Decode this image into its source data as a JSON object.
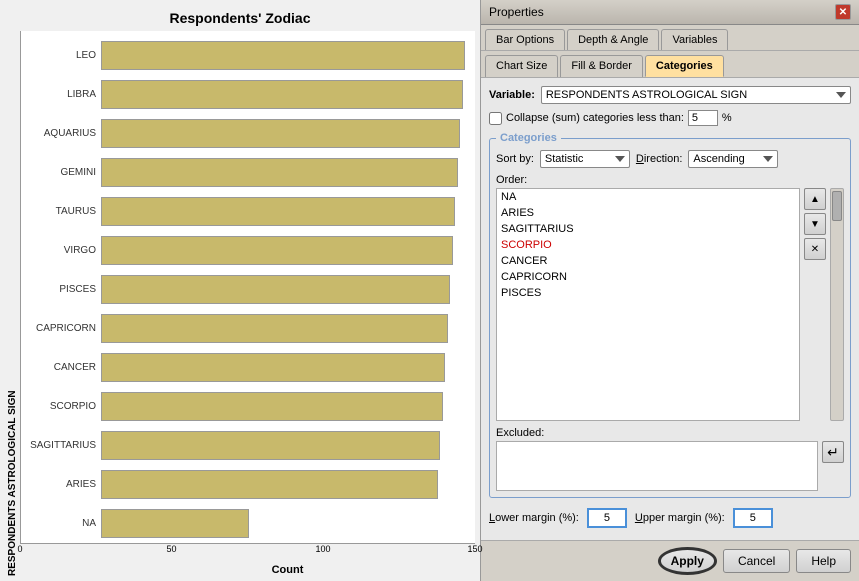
{
  "chart": {
    "title": "Respondents' Zodiac",
    "y_axis_label": "RESPONDENTS ASTROLOGICAL SIGN",
    "x_axis_label": "Count",
    "x_ticks": [
      "0",
      "50",
      "100",
      "150"
    ],
    "bars": [
      {
        "label": "LEO",
        "value": 148,
        "max": 150
      },
      {
        "label": "LIBRA",
        "value": 147,
        "max": 150
      },
      {
        "label": "AQUARIUS",
        "value": 146,
        "max": 150
      },
      {
        "label": "GEMINI",
        "value": 145,
        "max": 150
      },
      {
        "label": "TAURUS",
        "value": 144,
        "max": 150
      },
      {
        "label": "VIRGO",
        "value": 143,
        "max": 150
      },
      {
        "label": "PISCES",
        "value": 142,
        "max": 150
      },
      {
        "label": "CAPRICORN",
        "value": 141,
        "max": 150
      },
      {
        "label": "CANCER",
        "value": 140,
        "max": 150
      },
      {
        "label": "SCORPIO",
        "value": 139,
        "max": 150
      },
      {
        "label": "SAGITTARIUS",
        "value": 138,
        "max": 150
      },
      {
        "label": "ARIES",
        "value": 137,
        "max": 150
      },
      {
        "label": "NA",
        "value": 60,
        "max": 150
      }
    ]
  },
  "panel": {
    "title": "Properties",
    "tabs_row1": [
      {
        "label": "Bar Options",
        "active": false
      },
      {
        "label": "Depth & Angle",
        "active": false
      },
      {
        "label": "Variables",
        "active": false
      }
    ],
    "tabs_row2": [
      {
        "label": "Chart Size",
        "active": false
      },
      {
        "label": "Fill & Border",
        "active": false
      },
      {
        "label": "Categories",
        "active": true
      }
    ],
    "variable_label": "Variable:",
    "variable_value": "RESPONDENTS ASTROLOGICAL SIGN",
    "collapse_label": "Collapse (sum) categories less than:",
    "collapse_value": "5",
    "collapse_unit": "%",
    "categories_legend": "Categories",
    "sort_label": "Sort by:",
    "sort_value": "Statistic",
    "direction_label": "Direction:",
    "direction_value": "Ascending",
    "order_label": "Order:",
    "order_items": [
      {
        "label": "NA",
        "selected": false,
        "red": false
      },
      {
        "label": "ARIES",
        "selected": false,
        "red": false
      },
      {
        "label": "SAGITTARIUS",
        "selected": false,
        "red": false
      },
      {
        "label": "SCORPIO",
        "selected": false,
        "red": true
      },
      {
        "label": "CANCER",
        "selected": false,
        "red": false
      },
      {
        "label": "CAPRICORN",
        "selected": false,
        "red": false
      },
      {
        "label": "PISCES",
        "selected": false,
        "red": false
      }
    ],
    "excluded_label": "Excluded:",
    "lower_margin_label": "Lower margin (%):",
    "lower_margin_value": "5",
    "upper_margin_label": "Upper margin (%):",
    "upper_margin_value": "5",
    "buttons": {
      "apply": "Apply",
      "cancel": "Cancel",
      "help": "Help"
    }
  }
}
